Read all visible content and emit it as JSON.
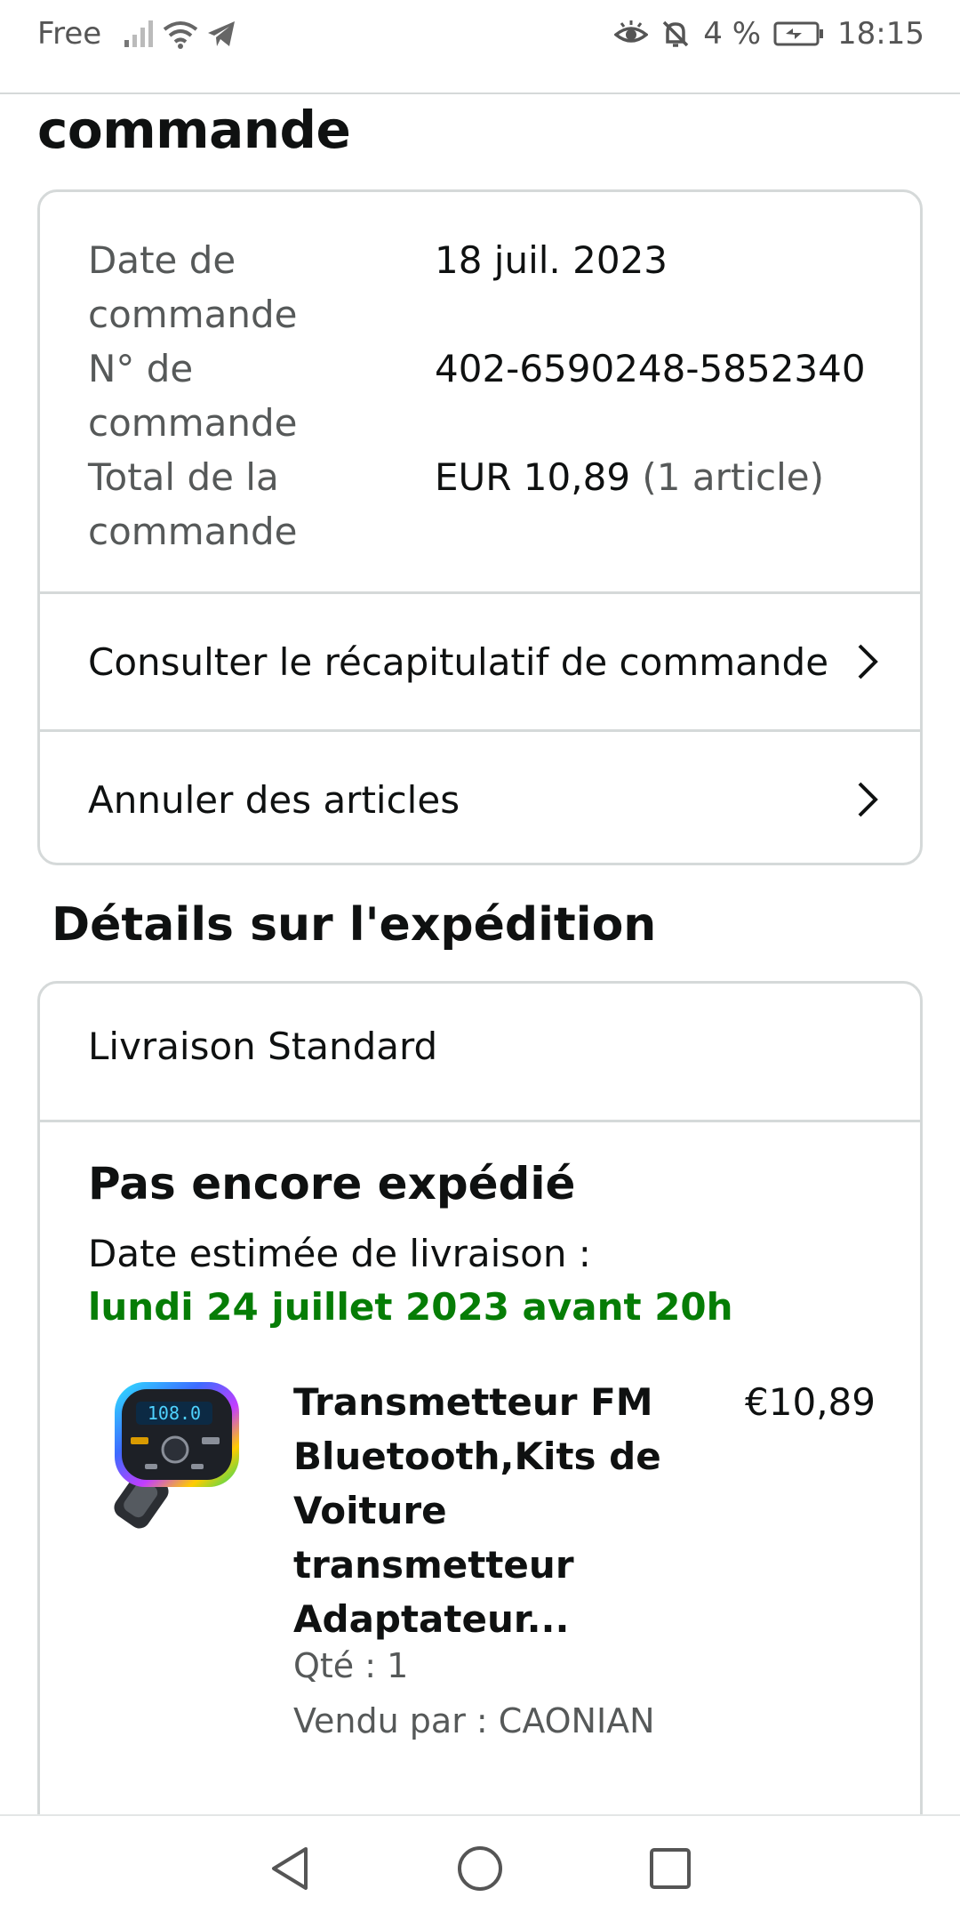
{
  "status_bar": {
    "carrier": "Free",
    "battery_percent": "4 %",
    "time": "18:15"
  },
  "page": {
    "heading": "commande"
  },
  "order_info": {
    "rows": [
      {
        "label_line1": "Date de",
        "label_line2": "commande",
        "value": "18 juil. 2023"
      },
      {
        "label_line1": "N° de",
        "label_line2": "commande",
        "value": "402-6590248-5852340"
      },
      {
        "label_line1": "Total de la",
        "label_line2": "commande",
        "value": "EUR 10,89",
        "value_extra": "(1 article)"
      }
    ],
    "links": [
      {
        "label": "Consulter le récapitulatif de commande"
      },
      {
        "label": "Annuler des articles"
      }
    ]
  },
  "shipping": {
    "section_title": "Détails sur l'expédition",
    "method": "Livraison Standard",
    "status": "Pas encore expédié",
    "estimate_label": "Date estimée de livraison :",
    "estimate_date": "lundi 24 juillet 2023 avant 20h",
    "accent_color": "#067d06"
  },
  "product": {
    "title_lines": [
      "Transmetteur FM",
      "Bluetooth,Kits de",
      "Voiture",
      "transmetteur",
      "Adaptateur..."
    ],
    "price": "€10,89",
    "quantity": "Qté : 1",
    "seller": "Vendu par : CAONIAN",
    "image_icon": "car-fm-transmitter-image"
  },
  "icons": {
    "signal": "signal-icon",
    "wifi": "wifi-icon",
    "telegram": "telegram-icon",
    "eye": "eye-comfort-icon",
    "mute": "bell-off-icon",
    "battery": "battery-charging-icon",
    "chevron": "chevron-right-icon",
    "back": "back-triangle-icon",
    "home": "home-circle-icon",
    "recents": "recents-square-icon"
  }
}
